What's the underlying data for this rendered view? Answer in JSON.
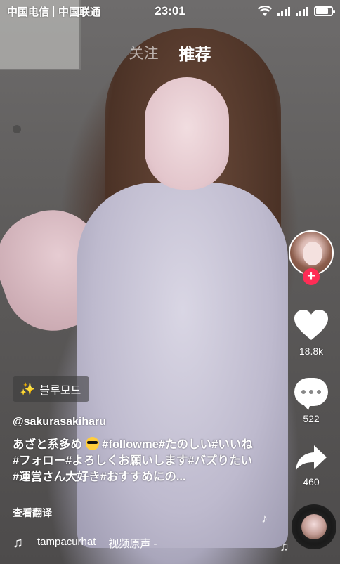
{
  "status_bar": {
    "carrier_1": "中国电信",
    "carrier_2": "中国联通",
    "time": "23:01"
  },
  "top_tabs": {
    "following": "关注",
    "recommended": "推荐"
  },
  "actions": {
    "likes": "18.8k",
    "comments": "522",
    "shares": "460"
  },
  "badge": {
    "label": "블루모드"
  },
  "post": {
    "username": "@sakurasakiharu",
    "caption_start": "あざと系多め",
    "caption_rest": " #followme#たのしい#いいね#フォロー#よろしくお願いします#バズりたい#運営さん大好き#おすすめにの...",
    "translate": "查看翻译"
  },
  "music": {
    "author": "tampacurhat",
    "title": "视频原声 -"
  },
  "colors": {
    "accent": "#fe2c55"
  }
}
